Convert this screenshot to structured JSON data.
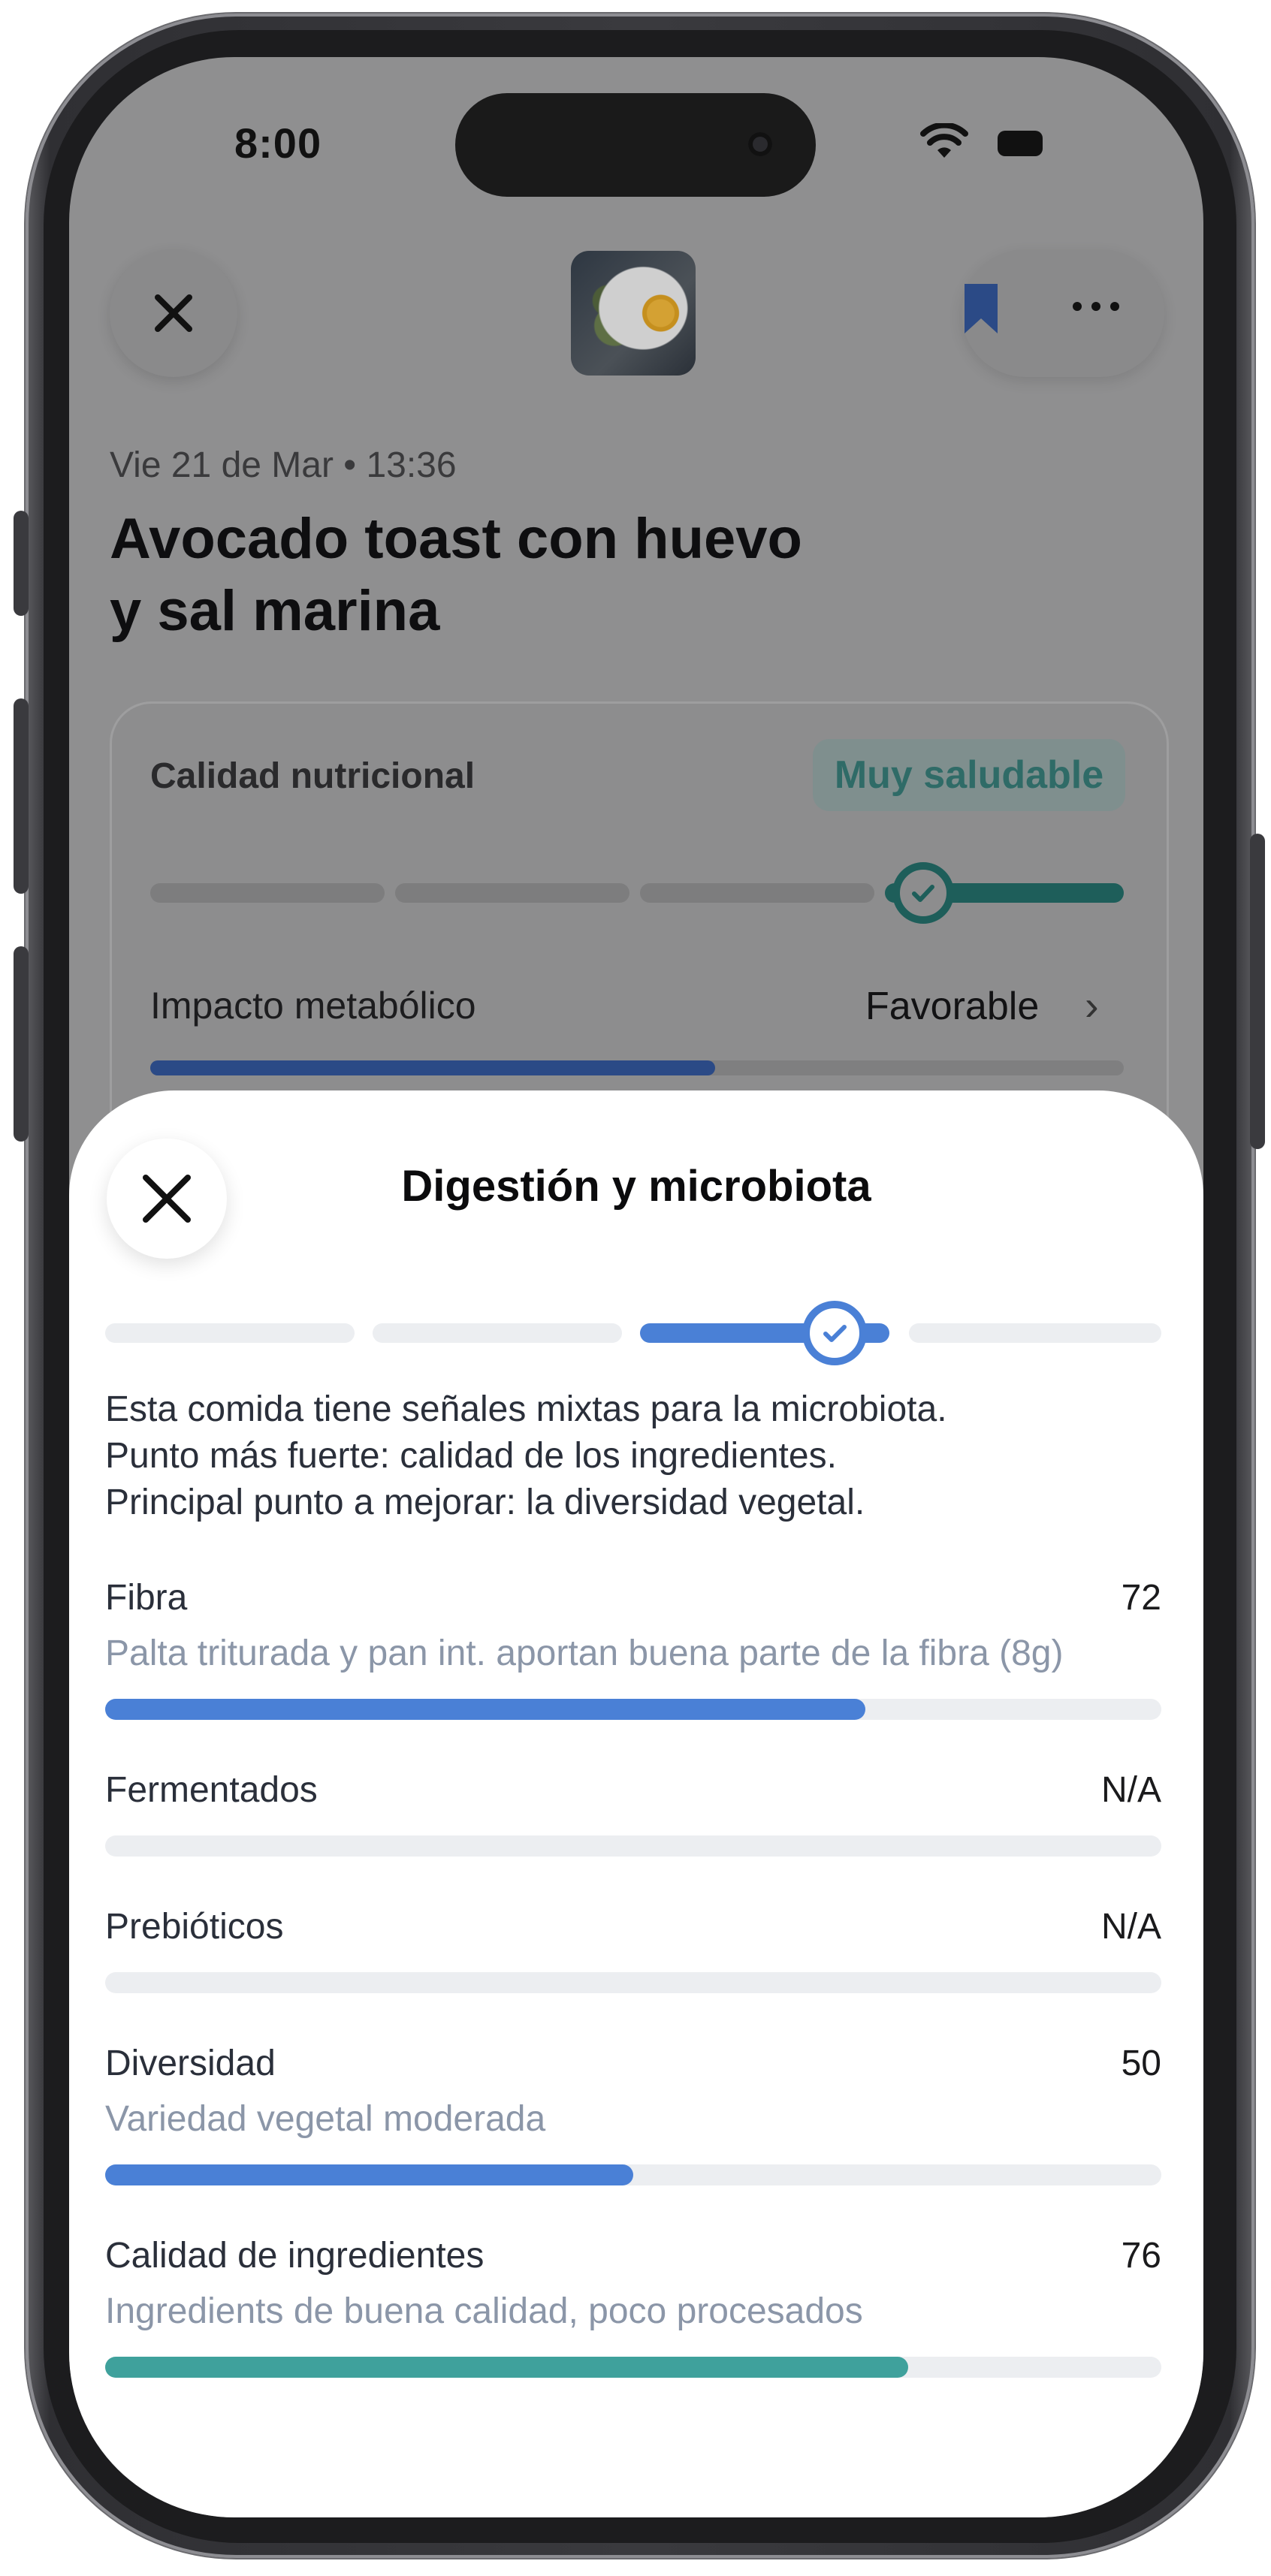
{
  "status_bar": {
    "time": "8:00"
  },
  "top_bar": {
    "close_icon": "close-icon",
    "bookmark_icon": "bookmark-icon",
    "more_icon": "more-icon",
    "thumbnail": "food-photo"
  },
  "meal": {
    "date": "Vie 21 de Mar • 13:36",
    "title_line1": "Avocado toast con huevo",
    "title_line2": "y sal marina"
  },
  "quality_card": {
    "label": "Calidad nutricional",
    "badge": "Muy saludable",
    "segments_total": 4,
    "active_segment": 4,
    "teal_color": "#1e5e5a",
    "metabolic": {
      "label": "Impacto metabólico",
      "value": "Favorable",
      "chevron": "›",
      "fill_percent": 58
    }
  },
  "sheet": {
    "title": "Digestión y microbiota",
    "close_icon": "close-icon",
    "segments_total": 4,
    "active_segment": 3,
    "accent": "#4a80d6",
    "summary": [
      "Esta comida tiene señales mixtas para la microbiota.",
      "Punto más fuerte: calidad de los ingredientes.",
      "Principal punto a mejorar: la diversidad vegetal."
    ],
    "metrics": [
      {
        "name": "Fibra",
        "score": "72",
        "description": "Palta triturada y pan int. aportan buena parte de la fibra (8g)",
        "fill_percent": 72,
        "color": "#4a80d6"
      },
      {
        "name": "Fermentados",
        "score": "N/A",
        "fill_percent": 0
      },
      {
        "name": "Prebióticos",
        "score": "N/A",
        "fill_percent": 0
      },
      {
        "name": "Diversidad",
        "score": "50",
        "description": "Variedad vegetal moderada",
        "fill_percent": 50,
        "color": "#4a80d6"
      },
      {
        "name": "Calidad de ingredientes",
        "score": "76",
        "description": "Ingredients de buena calidad, poco procesados",
        "fill_percent": 76,
        "color": "#3fa19c"
      }
    ]
  }
}
